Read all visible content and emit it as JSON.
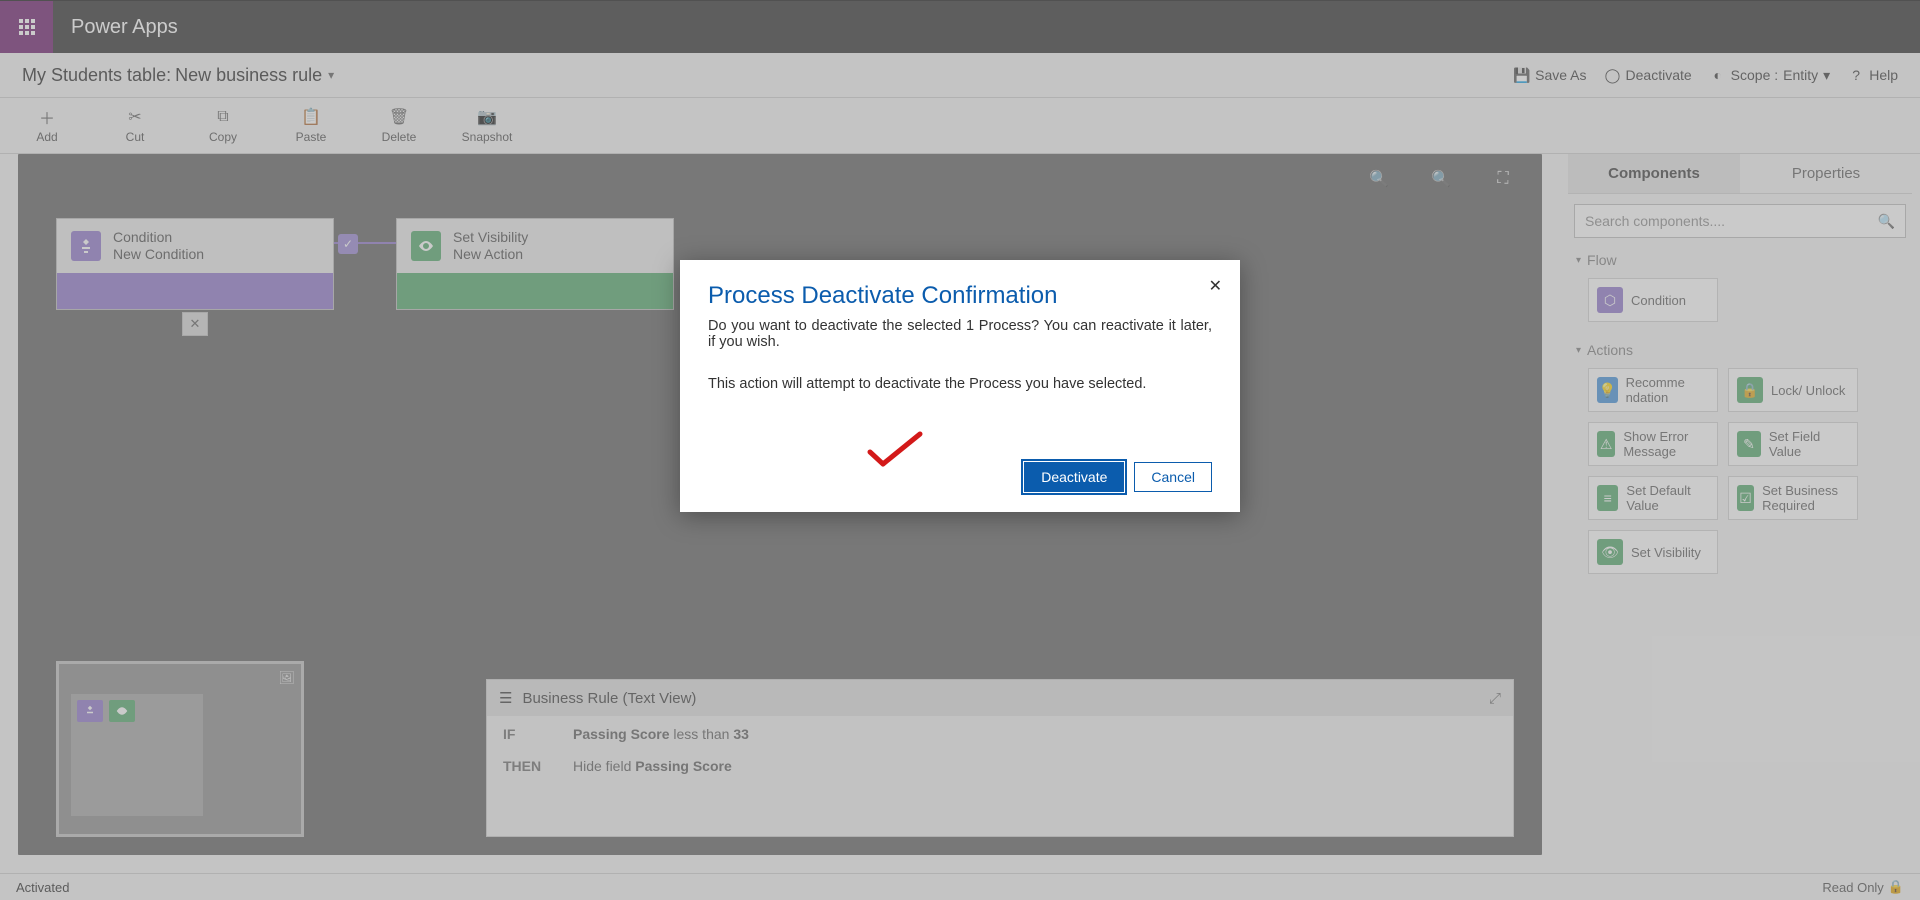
{
  "titlebar": {
    "app_name": "Power Apps"
  },
  "subbar": {
    "table_label": "My Students table:",
    "rule_name": "New business rule",
    "save_as": "Save As",
    "deactivate": "Deactivate",
    "scope_label": "Scope :",
    "scope_value": "Entity",
    "help": "Help"
  },
  "toolbar": {
    "add": "Add",
    "cut": "Cut",
    "copy": "Copy",
    "paste": "Paste",
    "delete": "Delete",
    "snapshot": "Snapshot"
  },
  "canvas": {
    "condition": {
      "title": "Condition",
      "subtitle": "New Condition"
    },
    "action": {
      "title": "Set Visibility",
      "subtitle": "New Action"
    }
  },
  "textview": {
    "title": "Business Rule (Text View)",
    "if": "IF",
    "if_field": "Passing Score",
    "if_op": "less than",
    "if_val": "33",
    "then": "THEN",
    "then_prefix": "Hide field",
    "then_field": "Passing Score"
  },
  "sidebar": {
    "tab_components": "Components",
    "tab_properties": "Properties",
    "search_placeholder": "Search components....",
    "group_flow": "Flow",
    "group_actions": "Actions",
    "items": {
      "condition": "Condition",
      "recommendation": "Recomme ndation",
      "lock_unlock": "Lock/ Unlock",
      "show_error": "Show Error Message",
      "set_field": "Set Field Value",
      "set_default": "Set Default Value",
      "set_required": "Set Business Required",
      "set_visibility": "Set Visibility"
    }
  },
  "statusbar": {
    "status": "Activated",
    "readonly": "Read Only"
  },
  "modal": {
    "title": "Process Deactivate Confirmation",
    "message1": "Do you want to deactivate the selected 1 Process? You can reactivate it later, if you wish.",
    "message2": "This action will attempt to deactivate the Process you have selected.",
    "confirm": "Deactivate",
    "cancel": "Cancel"
  }
}
